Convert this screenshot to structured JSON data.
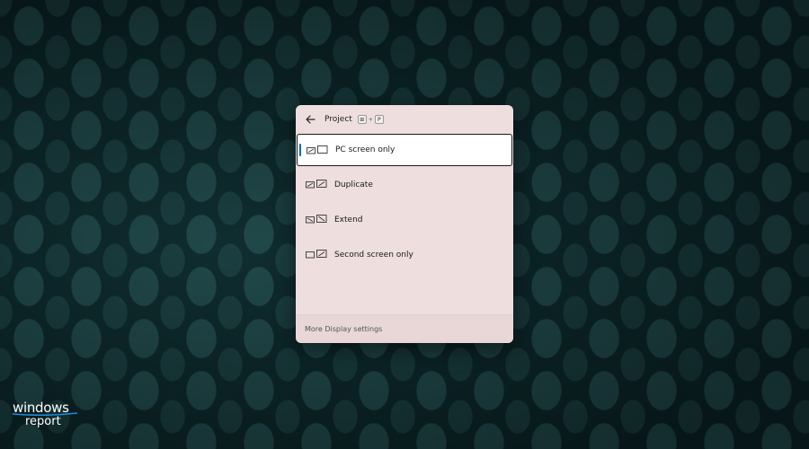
{
  "panel": {
    "title": "Project",
    "shortcut": {
      "key1": "⊞",
      "plus": "+",
      "key2": "P"
    },
    "options": [
      {
        "label": "PC screen only",
        "icon": "pc-screen-only-icon",
        "selected": true
      },
      {
        "label": "Duplicate",
        "icon": "duplicate-icon",
        "selected": false
      },
      {
        "label": "Extend",
        "icon": "extend-icon",
        "selected": false
      },
      {
        "label": "Second screen only",
        "icon": "second-screen-only-icon",
        "selected": false
      }
    ],
    "footer_link": "More Display settings"
  },
  "watermark": {
    "line1": "windows",
    "line2": "report"
  },
  "colors": {
    "accent": "#0067c0",
    "panel_bg": "#efdede",
    "desktop_bg": "#0a2326"
  }
}
